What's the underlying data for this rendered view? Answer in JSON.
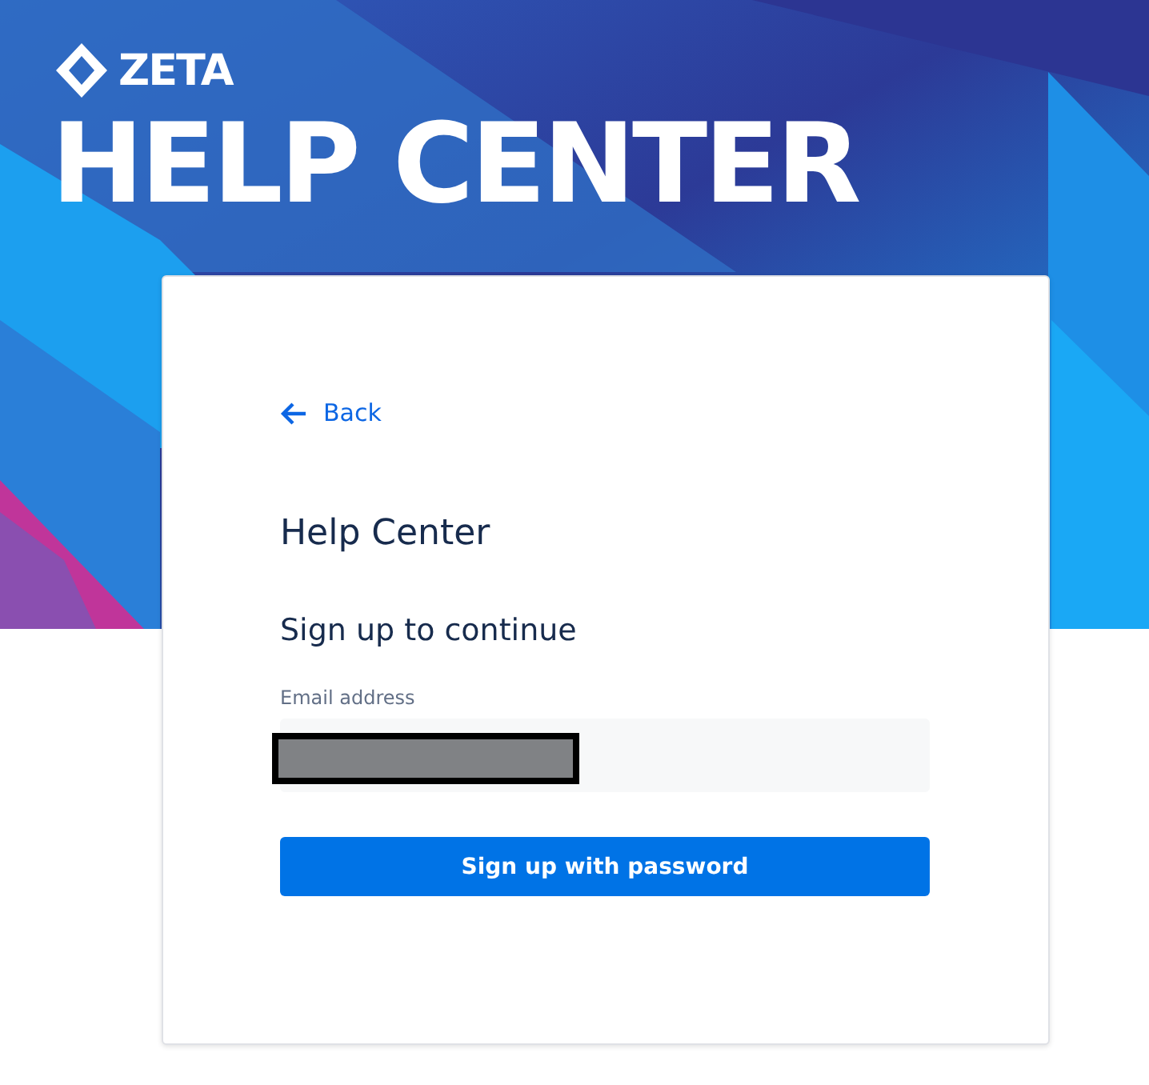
{
  "brand": {
    "logo_text": "ZETA",
    "title": "HELP CENTER"
  },
  "card": {
    "back_link": "Back",
    "heading": "Help Center",
    "subheading": "Sign up to continue",
    "email_field": {
      "label": "Email address",
      "value_redacted": true
    },
    "submit_button": "Sign up with password"
  }
}
